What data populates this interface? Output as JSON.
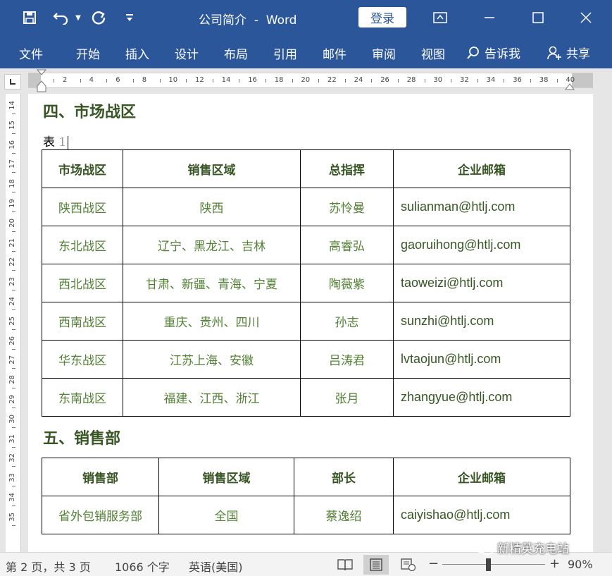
{
  "titlebar": {
    "doc_name": "公司简介",
    "separator": "-",
    "app_name": "Word",
    "login_label": "登录",
    "icons": [
      "save-icon",
      "undo-icon",
      "redo-icon",
      "customize-icon",
      "ribbon-display-icon",
      "minimize-icon",
      "maximize-icon",
      "close-icon"
    ]
  },
  "ribbon": {
    "tabs": [
      "文件",
      "开始",
      "插入",
      "设计",
      "布局",
      "引用",
      "邮件",
      "审阅",
      "视图"
    ],
    "tell_me": "告诉我",
    "share": "共享"
  },
  "ruler": {
    "h_marks": [
      "2",
      "4",
      "6",
      "8",
      "10",
      "12",
      "14",
      "16",
      "18",
      "20",
      "22",
      "24",
      "26",
      "28",
      "30",
      "32",
      "34",
      "36",
      "38",
      "40"
    ],
    "v_marks": [
      "14",
      "15",
      "16",
      "17",
      "18",
      "19",
      "20",
      "21",
      "22",
      "23",
      "24",
      "25",
      "26",
      "27",
      "28",
      "29",
      "30",
      "31",
      "32",
      "33",
      "34",
      "35"
    ]
  },
  "document": {
    "section4_title": "四、市场战区",
    "caption_label": "表",
    "caption_num": "1",
    "table1": {
      "headers": [
        "市场战区",
        "销售区域",
        "总指挥",
        "企业邮箱"
      ],
      "rows": [
        [
          "陕西战区",
          "陕西",
          "苏怜曼",
          "sulianman@htlj.com"
        ],
        [
          "东北战区",
          "辽宁、黑龙江、吉林",
          "高睿弘",
          "gaoruihong@htlj.com"
        ],
        [
          "西北战区",
          "甘肃、新疆、青海、宁夏",
          "陶薇紫",
          "taoweizi@htlj.com"
        ],
        [
          "西南战区",
          "重庆、贵州、四川",
          "孙志",
          "sunzhi@htlj.com"
        ],
        [
          "华东战区",
          "江苏上海、安徽",
          "吕涛君",
          "lvtaojun@htlj.com"
        ],
        [
          "东南战区",
          "福建、江西、浙江",
          "张月",
          "zhangyue@htlj.com"
        ]
      ]
    },
    "section5_title": "五、销售部",
    "table2": {
      "headers": [
        "销售部",
        "销售区域",
        "部长",
        "企业邮箱"
      ],
      "rows": [
        [
          "省外包销服务部",
          "全国",
          "蔡逸绍",
          "caiyishao@htlj.com"
        ]
      ]
    }
  },
  "statusbar": {
    "page_info": "第 2 页，共 3 页",
    "word_count": "1066 个字",
    "language": "英语(美国)",
    "zoom_minus": "−",
    "zoom_plus": "+",
    "zoom_level": "90%",
    "watermark": "新精英充电站"
  }
}
